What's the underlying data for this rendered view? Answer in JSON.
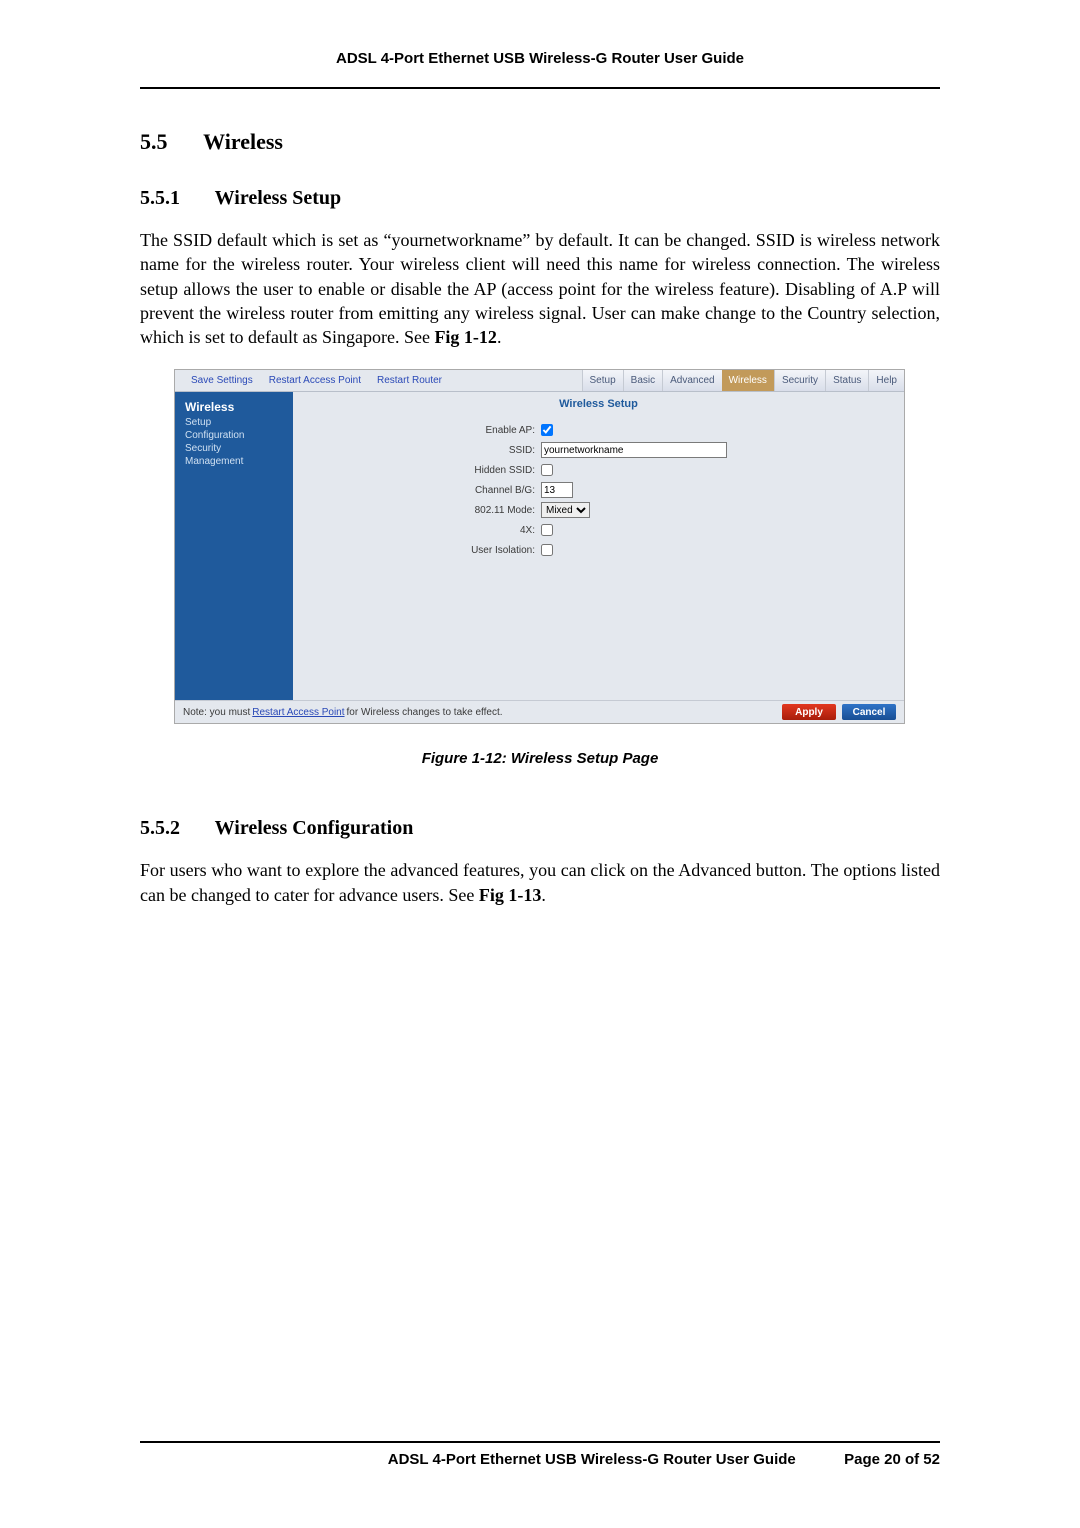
{
  "doc": {
    "header_title": "ADSL 4-Port Ethernet USB Wireless-G Router User Guide",
    "footer_title": "ADSL 4-Port Ethernet USB Wireless-G Router User Guide",
    "footer_page": "Page 20 of 52"
  },
  "sections": {
    "s55_num": "5.5",
    "s55_title": "Wireless",
    "s551_num": "5.5.1",
    "s551_title": "Wireless Setup",
    "s551_body_1": "The SSID default which is set as “yournetworkname” by default. It can be changed. SSID is wireless network name for the wireless router. Your wireless client will need this name for wireless connection. The wireless setup allows the user to enable or disable the AP (access point for the wireless feature). Disabling of A.P will prevent the wireless router from emitting any wireless signal. User can make change to the Country selection, which is set to default as Singapore. See ",
    "s551_body_ref": "Fig 1-12",
    "s551_body_2": ".",
    "fig_caption": "Figure 1-12: Wireless Setup Page",
    "s552_num": "5.5.2",
    "s552_title": "Wireless Configuration",
    "s552_body_1": "For users who want to explore the advanced features, you can click on the Advanced button. The options listed can be changed to cater for advance users. See ",
    "s552_body_ref": "Fig 1-13",
    "s552_body_2": "."
  },
  "router_ui": {
    "links": {
      "save": "Save Settings",
      "restart_ap": "Restart Access Point",
      "restart_router": "Restart Router"
    },
    "tabs": {
      "setup": "Setup",
      "basic": "Basic",
      "advanced": "Advanced",
      "wireless": "Wireless",
      "security": "Security",
      "status": "Status",
      "help": "Help"
    },
    "sidebar": {
      "title": "Wireless",
      "items": [
        "Setup",
        "Configuration",
        "Security",
        "Management"
      ]
    },
    "content_title": "Wireless Setup",
    "form": {
      "enable_ap_label": "Enable AP:",
      "enable_ap_checked": true,
      "ssid_label": "SSID:",
      "ssid_value": "yournetworkname",
      "hidden_ssid_label": "Hidden SSID:",
      "hidden_ssid_checked": false,
      "channel_label": "Channel B/G:",
      "channel_value": "13",
      "mode_label": "802.11 Mode:",
      "mode_value": "Mixed",
      "fourx_label": "4X:",
      "fourx_checked": false,
      "isolation_label": "User Isolation:",
      "isolation_checked": false
    },
    "footer": {
      "note_prefix": "Note: you must ",
      "note_link": "Restart Access Point",
      "note_suffix": " for Wireless changes to take effect.",
      "apply": "Apply",
      "cancel": "Cancel"
    }
  }
}
